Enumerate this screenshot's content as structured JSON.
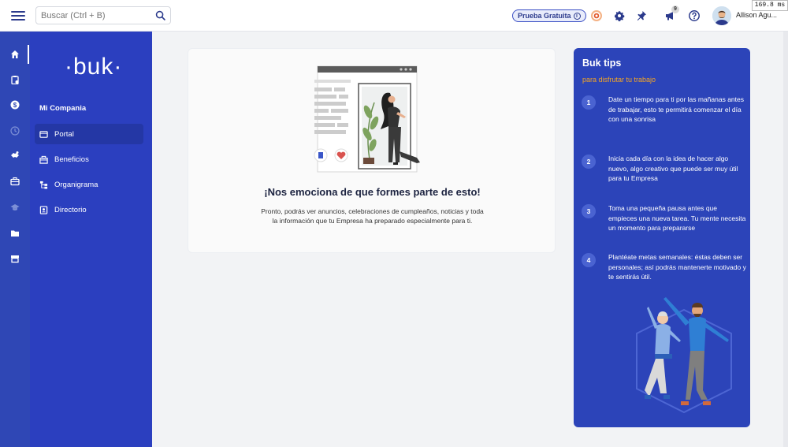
{
  "header": {
    "search_placeholder": "Buscar (Ctrl + B)",
    "trial_label": "Prueba Gratuita",
    "notification_count": "9",
    "user_name": "Allison Agu...",
    "timer": "169.8 ms"
  },
  "sidebar": {
    "logo": "·buk·",
    "company": "Mi Compania",
    "items": [
      {
        "label": "Portal",
        "icon": "portal-icon"
      },
      {
        "label": "Beneficios",
        "icon": "gift-icon"
      },
      {
        "label": "Organigrama",
        "icon": "org-chart-icon"
      },
      {
        "label": "Directorio",
        "icon": "directory-icon"
      }
    ]
  },
  "rail": {
    "icons": [
      "home-icon",
      "clipboard-icon",
      "dollar-icon",
      "clock-icon",
      "handshake-icon",
      "briefcase-icon",
      "graduation-icon",
      "folder-icon",
      "store-icon"
    ]
  },
  "welcome": {
    "title": "¡Nos emociona de que formes parte de esto!",
    "text": "Pronto, podrás ver anuncios, celebraciones de cumpleaños, noticias y toda la información que tu Empresa ha preparado especialmente para ti."
  },
  "tips": {
    "title": "Buk tips",
    "subtitle": "para disfrutar tu trabajo",
    "items": [
      {
        "n": "1",
        "text": "Date un tiempo para ti por las mañanas antes de trabajar, esto te permitirá comenzar el día con una sonrisa"
      },
      {
        "n": "2",
        "text": "Inicia cada día con la idea de hacer algo nuevo, algo creativo que puede ser muy útil para tu Empresa"
      },
      {
        "n": "3",
        "text": "Toma una pequeña pausa antes que empieces una nueva tarea. Tu mente necesita un momento para prepararse"
      },
      {
        "n": "4",
        "text": "Plantéate metas semanales: éstas deben ser personales; así podrás mantenerte motivado y te sentirás útil."
      }
    ]
  },
  "colors": {
    "primary": "#2b3fbf",
    "rail": "#2f47b5",
    "accent": "#f5a623",
    "background": "#f2f3f5"
  }
}
